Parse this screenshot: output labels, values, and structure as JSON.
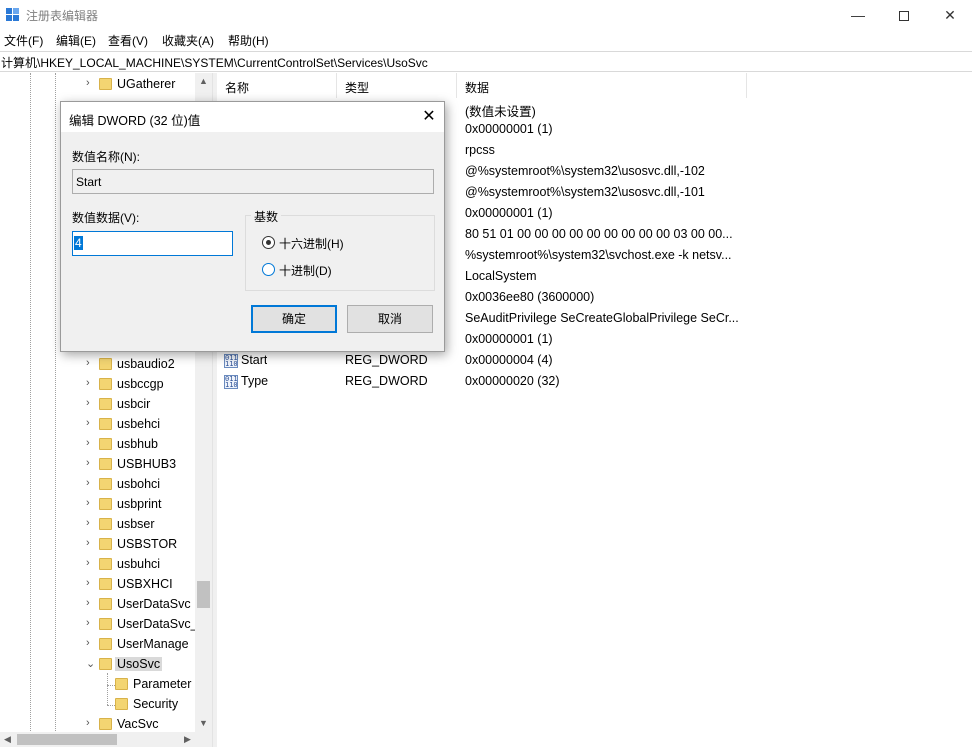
{
  "window": {
    "title": "注册表编辑器",
    "minimize": "—",
    "close": "✕"
  },
  "menu": [
    "文件(F)",
    "编辑(E)",
    "查看(V)",
    "收藏夹(A)",
    "帮助(H)"
  ],
  "address": "计算机\\HKEY_LOCAL_MACHINE\\SYSTEM\\CurrentControlSet\\Services\\UsoSvc",
  "tree": {
    "items": [
      {
        "label": "UGatherer",
        "expander": "›"
      },
      {
        "label": "usbaudio2",
        "expander": "›"
      },
      {
        "label": "usbccgp",
        "expander": "›"
      },
      {
        "label": "usbcir",
        "expander": "›"
      },
      {
        "label": "usbehci",
        "expander": "›"
      },
      {
        "label": "usbhub",
        "expander": "›"
      },
      {
        "label": "USBHUB3",
        "expander": "›"
      },
      {
        "label": "usbohci",
        "expander": "›"
      },
      {
        "label": "usbprint",
        "expander": "›"
      },
      {
        "label": "usbser",
        "expander": "›"
      },
      {
        "label": "USBSTOR",
        "expander": "›"
      },
      {
        "label": "usbuhci",
        "expander": "›"
      },
      {
        "label": "USBXHCI",
        "expander": "›"
      },
      {
        "label": "UserDataSvc",
        "expander": "›"
      },
      {
        "label": "UserDataSvc_",
        "expander": "›"
      },
      {
        "label": "UserManage",
        "expander": "›"
      },
      {
        "label": "UsoSvc",
        "expander": "⌄"
      },
      {
        "label": "Parameter",
        "expander": ""
      },
      {
        "label": "Security",
        "expander": ""
      },
      {
        "label": "VacSvc",
        "expander": "›"
      }
    ],
    "scroll_up": "▲",
    "scroll_down": "▼",
    "scroll_left": "◀",
    "scroll_right": "▶"
  },
  "list": {
    "columns": [
      "名称",
      "类型",
      "数据"
    ],
    "data_values": [
      "(数值未设置)",
      "0x00000001 (1)",
      "rpcss",
      "@%systemroot%\\system32\\usosvc.dll,-102",
      "@%systemroot%\\system32\\usosvc.dll,-101",
      "0x00000001 (1)",
      "80 51 01 00 00 00 00 00 00 00 00 00 03 00 00...",
      "%systemroot%\\system32\\svchost.exe -k netsv...",
      "LocalSystem",
      "0x0036ee80 (3600000)",
      "SeAuditPrivilege SeCreateGlobalPrivilege SeCr...",
      "0x00000001 (1)"
    ],
    "visible_rows": [
      {
        "name": "Start",
        "type": "REG_DWORD",
        "data": "0x00000004 (4)",
        "icon": "reg-dword-icon",
        "icon_text": "011\n110"
      },
      {
        "name": "Type",
        "type": "REG_DWORD",
        "data": "0x00000020 (32)",
        "icon": "reg-dword-icon",
        "icon_text": "011\n110"
      }
    ]
  },
  "dialog": {
    "title": "编辑 DWORD (32 位)值",
    "close": "✕",
    "name_label": "数值名称(N):",
    "name_value": "Start",
    "data_label": "数值数据(V):",
    "data_value": "4",
    "base_label": "基数",
    "hex_label": "十六进制(H)",
    "dec_label": "十进制(D)",
    "hex_selected": true,
    "ok": "确定",
    "cancel": "取消"
  }
}
